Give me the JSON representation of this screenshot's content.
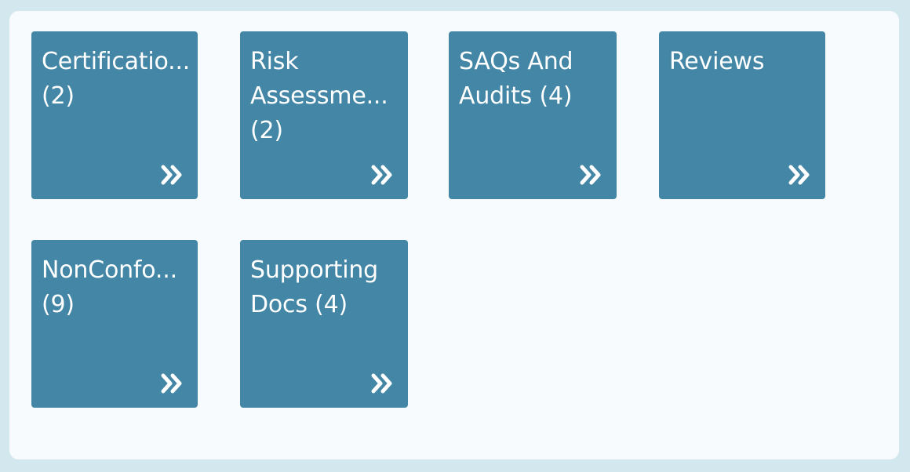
{
  "panel": {
    "tiles": [
      {
        "line1": "Certificatio...",
        "line2": "(2)",
        "line3": ""
      },
      {
        "line1": "Risk",
        "line2": "Assessme...",
        "line3": "(2)"
      },
      {
        "line1": "SAQs And",
        "line2": "Audits (4)",
        "line3": ""
      },
      {
        "line1": "Reviews",
        "line2": "",
        "line3": ""
      },
      {
        "line1": "NonConfo...",
        "line2": "(9)",
        "line3": ""
      },
      {
        "line1": "Supporting",
        "line2": "Docs (4)",
        "line3": ""
      }
    ],
    "arrow_icon": "double-chevron-right-icon"
  },
  "colors": {
    "page_background": "#d3e7ee",
    "panel_background": "#f8fbfd",
    "tile_background": "#4386a5",
    "tile_text": "#ffffff"
  }
}
